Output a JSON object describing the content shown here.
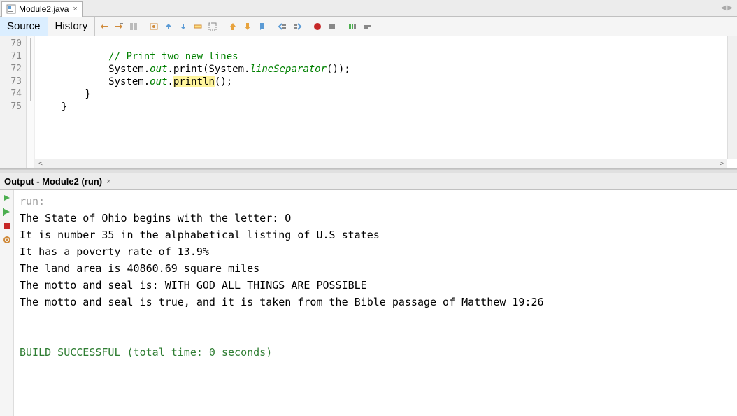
{
  "tab": {
    "file_name": "Module2.java",
    "close_glyph": "×"
  },
  "nav": {
    "left": "◀",
    "right": "▶"
  },
  "editor_views": {
    "source": "Source",
    "history": "History"
  },
  "gutter_lines": [
    "70",
    "71",
    "72",
    "73",
    "74",
    "75"
  ],
  "code": {
    "l70": "",
    "l71_indent": "            ",
    "l71_comment": "// Print two new lines",
    "l72_a": "            System.",
    "l72_out": "out",
    "l72_b": ".print(System.",
    "l72_c": "lineSeparator",
    "l72_d": "());",
    "l73_a": "            System.",
    "l73_out": "out",
    "l73_b": ".",
    "l73_println": "println",
    "l73_c": "();",
    "l74": "        }",
    "l75": "    }"
  },
  "output": {
    "title": "Output - Module2 (run)",
    "close_glyph": "×",
    "run_label": "run:",
    "lines": [
      "The State of Ohio begins with the letter: O",
      "It is number 35 in the alphabetical listing of U.S states",
      "It has a poverty rate of 13.9%",
      "The land area is 40860.69 square miles",
      "The motto and seal is: WITH GOD ALL THINGS ARE POSSIBLE",
      "The motto and seal is true, and it is taken from the Bible passage of Matthew 19:26"
    ],
    "build_msg": "BUILD SUCCESSFUL (total time: 0 seconds)"
  }
}
